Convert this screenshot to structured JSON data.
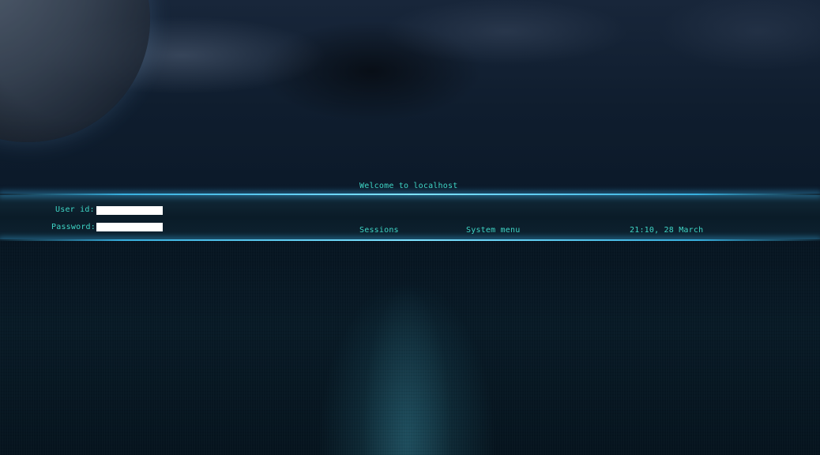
{
  "greeting": {
    "welcome_text": "Welcome to localhost"
  },
  "login": {
    "user_label": "User id:",
    "user_value": "",
    "password_label": "Password:",
    "password_value": ""
  },
  "menu": {
    "sessions_label": "Sessions",
    "system_menu_label": "System menu"
  },
  "status": {
    "datetime": "21:10, 28 March"
  },
  "theme": {
    "text_color": "#3fd6c6",
    "glow_color": "#7fe3ff",
    "field_color": "#ffffff"
  }
}
